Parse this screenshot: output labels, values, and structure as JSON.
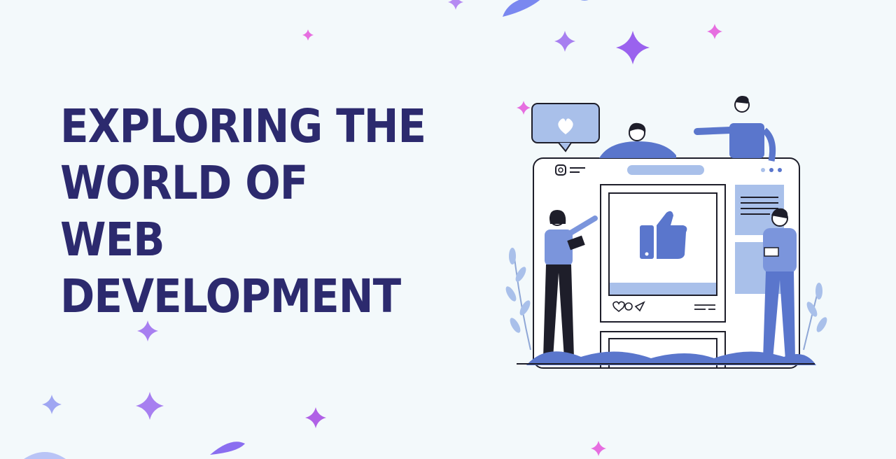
{
  "heading": {
    "lines": [
      "EXPLORING THE",
      "WORLD OF",
      "WEB",
      "DEVELOPMENT"
    ]
  },
  "colors": {
    "background": "#f3f9fb",
    "heading": "#2c2a6e",
    "accent_blue": "#5a76cc",
    "light_blue": "#a9c0ea",
    "outline": "#1e1e2a",
    "sparkle_purple": "#a77ff0",
    "sparkle_pink": "#e66ee0"
  },
  "illustration": {
    "icon_names": [
      "heart-icon",
      "thumbs-up-icon",
      "instagram-icon",
      "comment-icon",
      "send-icon"
    ]
  }
}
